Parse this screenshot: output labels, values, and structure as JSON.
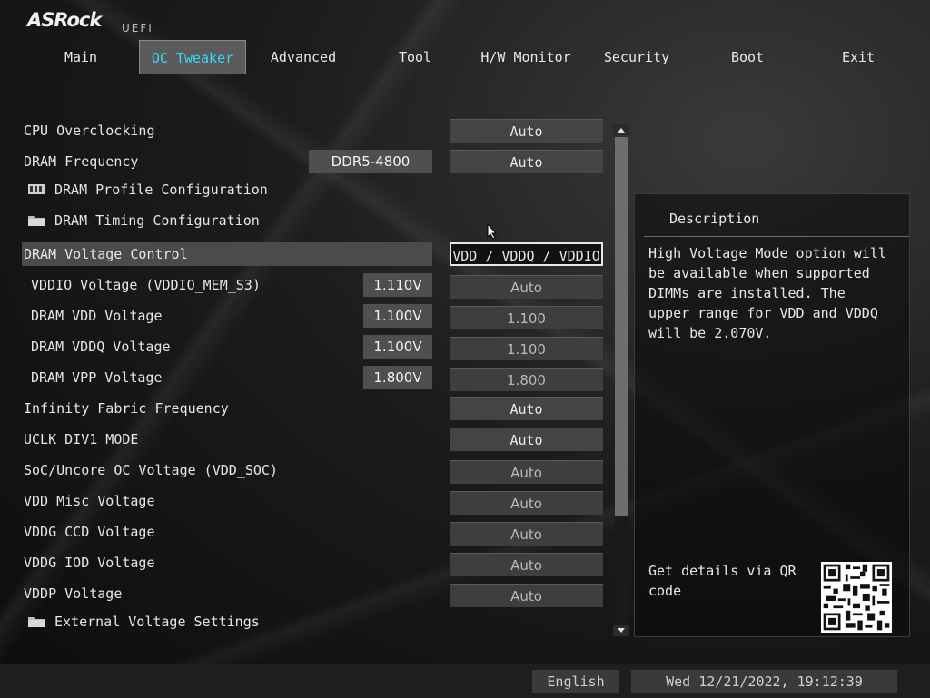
{
  "brand": {
    "logo": "ASRock",
    "sub": "UEFI"
  },
  "tabs": [
    {
      "label": "Main"
    },
    {
      "label": "OC Tweaker"
    },
    {
      "label": "Advanced"
    },
    {
      "label": "Tool"
    },
    {
      "label": "H/W Monitor"
    },
    {
      "label": "Security"
    },
    {
      "label": "Boot"
    },
    {
      "label": "Exit"
    }
  ],
  "active_tab": "OC Tweaker",
  "settings": [
    {
      "label": "CPU Overclocking",
      "option": "Auto"
    },
    {
      "label": "DRAM Frequency",
      "current": "DDR5-4800",
      "option": "Auto"
    },
    {
      "label": "DRAM Profile Configuration",
      "icon": "memory-icon"
    },
    {
      "label": "DRAM Timing Configuration",
      "icon": "folder-icon"
    },
    {
      "label": "DRAM Voltage Control",
      "option": "VDD / VDDQ / VDDIO"
    },
    {
      "label": "VDDIO Voltage (VDDIO_MEM_S3)",
      "current": "1.110V",
      "option": "Auto"
    },
    {
      "label": "DRAM VDD Voltage",
      "current": "1.100V",
      "option": "1.100"
    },
    {
      "label": "DRAM VDDQ Voltage",
      "current": "1.100V",
      "option": "1.100"
    },
    {
      "label": "DRAM VPP Voltage",
      "current": "1.800V",
      "option": "1.800"
    },
    {
      "label": "Infinity Fabric Frequency",
      "option": "Auto"
    },
    {
      "label": "UCLK DIV1 MODE",
      "option": "Auto"
    },
    {
      "label": "SoC/Uncore OC Voltage (VDD_SOC)",
      "option": "Auto"
    },
    {
      "label": "VDD Misc Voltage",
      "option": "Auto"
    },
    {
      "label": "VDDG CCD Voltage",
      "option": "Auto"
    },
    {
      "label": "VDDG IOD Voltage",
      "option": "Auto"
    },
    {
      "label": "VDDP Voltage",
      "option": "Auto"
    },
    {
      "label": "External Voltage Settings",
      "icon": "folder-icon"
    }
  ],
  "selected_setting": "DRAM Voltage Control",
  "description": {
    "title": "Description",
    "body": "High Voltage Mode option will be available when supported DIMMs are installed. The upper range for VDD and VDDQ will be 2.070V.",
    "qr_text": "Get details via QR code"
  },
  "footer": {
    "language": "English",
    "datetime": "Wed 12/21/2022, 19:12:39"
  },
  "colors": {
    "active_tab_text": "#35d8ff",
    "active_tab_bg": "#5b5b5b"
  }
}
